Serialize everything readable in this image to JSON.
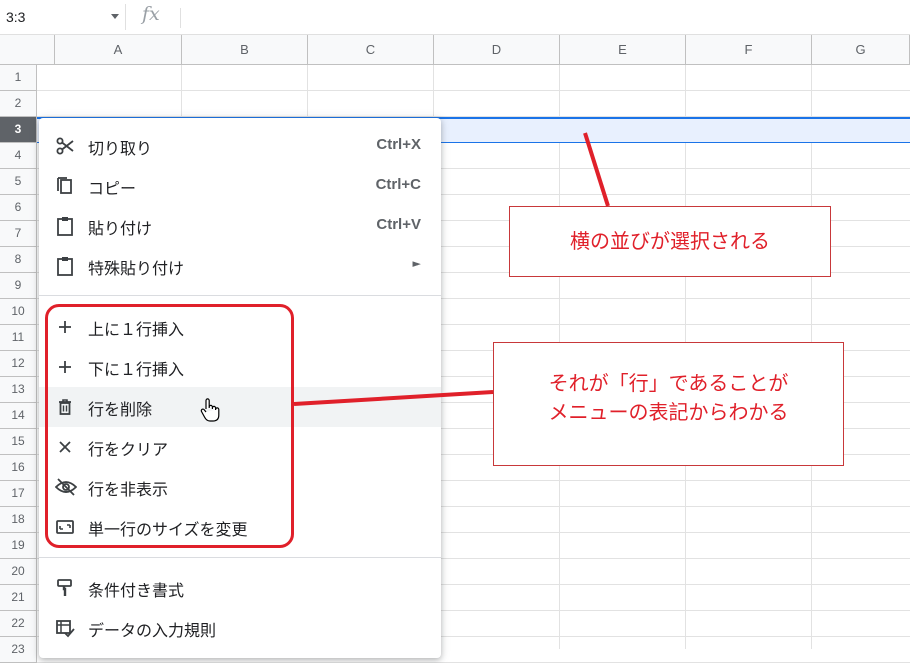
{
  "formula_bar": {
    "name_box": "3:3",
    "fx": "fx",
    "formula": ""
  },
  "columns": [
    "A",
    "B",
    "C",
    "D",
    "E",
    "F",
    "G"
  ],
  "rows": [
    "1",
    "2",
    "3",
    "4",
    "5",
    "6",
    "7",
    "8",
    "9",
    "10",
    "11",
    "12",
    "13",
    "14",
    "15",
    "16",
    "17",
    "18",
    "19",
    "20",
    "21",
    "22",
    "23"
  ],
  "selected_row": "3",
  "context_menu": {
    "items": [
      {
        "label": "切り取り",
        "shortcut": "Ctrl+X",
        "icon": "scissors-icon"
      },
      {
        "label": "コピー",
        "shortcut": "Ctrl+C",
        "icon": "copy-icon"
      },
      {
        "label": "貼り付け",
        "shortcut": "Ctrl+V",
        "icon": "clipboard-icon"
      },
      {
        "label": "特殊貼り付け",
        "submenu": "►",
        "icon": "clipboard-icon"
      },
      {
        "label": "上に１行挿入",
        "icon": "plus-icon"
      },
      {
        "label": "下に１行挿入",
        "icon": "plus-icon"
      },
      {
        "label": "行を削除",
        "icon": "trash-icon"
      },
      {
        "label": "行をクリア",
        "icon": "close-icon"
      },
      {
        "label": "行を非表示",
        "icon": "eye-off-icon"
      },
      {
        "label": "単一行のサイズを変更",
        "icon": "resize-icon"
      },
      {
        "label": "条件付き書式",
        "icon": "paint-roller-icon"
      },
      {
        "label": "データの入力規則",
        "icon": "data-validation-icon"
      }
    ]
  },
  "annotations": {
    "note1": "横の並びが選択される",
    "note2_line1": "それが「行」であることが",
    "note2_line2": "メニューの表記からわかる"
  },
  "colors": {
    "accent": "#1a73e8",
    "annotation_red": "#e0202a",
    "selection_fill": "#e8f0fe"
  }
}
